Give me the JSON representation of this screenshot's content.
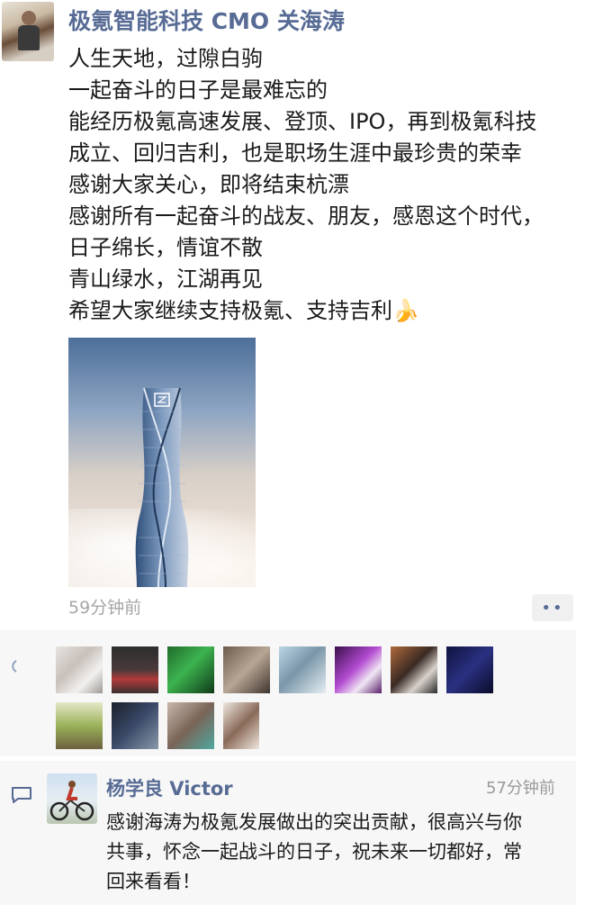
{
  "post": {
    "author": "极氪智能科技 CMO 关海涛",
    "lines": [
      "人生天地，过隙白驹",
      "一起奋斗的日子是最难忘的",
      "能经历极氪高速发展、登顶、IPO，再到极氪科技",
      "成立、回归吉利，也是职场生涯中最珍贵的荣幸",
      "感谢大家关心，即将结束杭漂",
      "感谢所有一起奋斗的战友、朋友，感恩这个时代，",
      "日子绵长，情谊不散",
      "青山绿水，江湖再见",
      "希望大家继续支持极氪、支持吉利"
    ],
    "emoji": "🍌",
    "image_icon": "tower-photo",
    "time": "59分钟前",
    "more_label": "••"
  },
  "likes": {
    "icon": "heart-outline-icon",
    "avatars_row1": 8,
    "avatars_row2": 4
  },
  "comment": {
    "icon": "comment-icon",
    "author": "杨学良 Victor",
    "time": "57分钟前",
    "lines": [
      "感谢海涛为极氪发展做出的突出贡献，很高兴与你",
      "共事，怀念一起战斗的日子，祝未来一切都好，常",
      "回来看看！"
    ]
  },
  "colors": {
    "name": "#576b95",
    "text": "#1a1a1a",
    "meta": "#a6a6a6",
    "panel": "#f7f7f7"
  }
}
